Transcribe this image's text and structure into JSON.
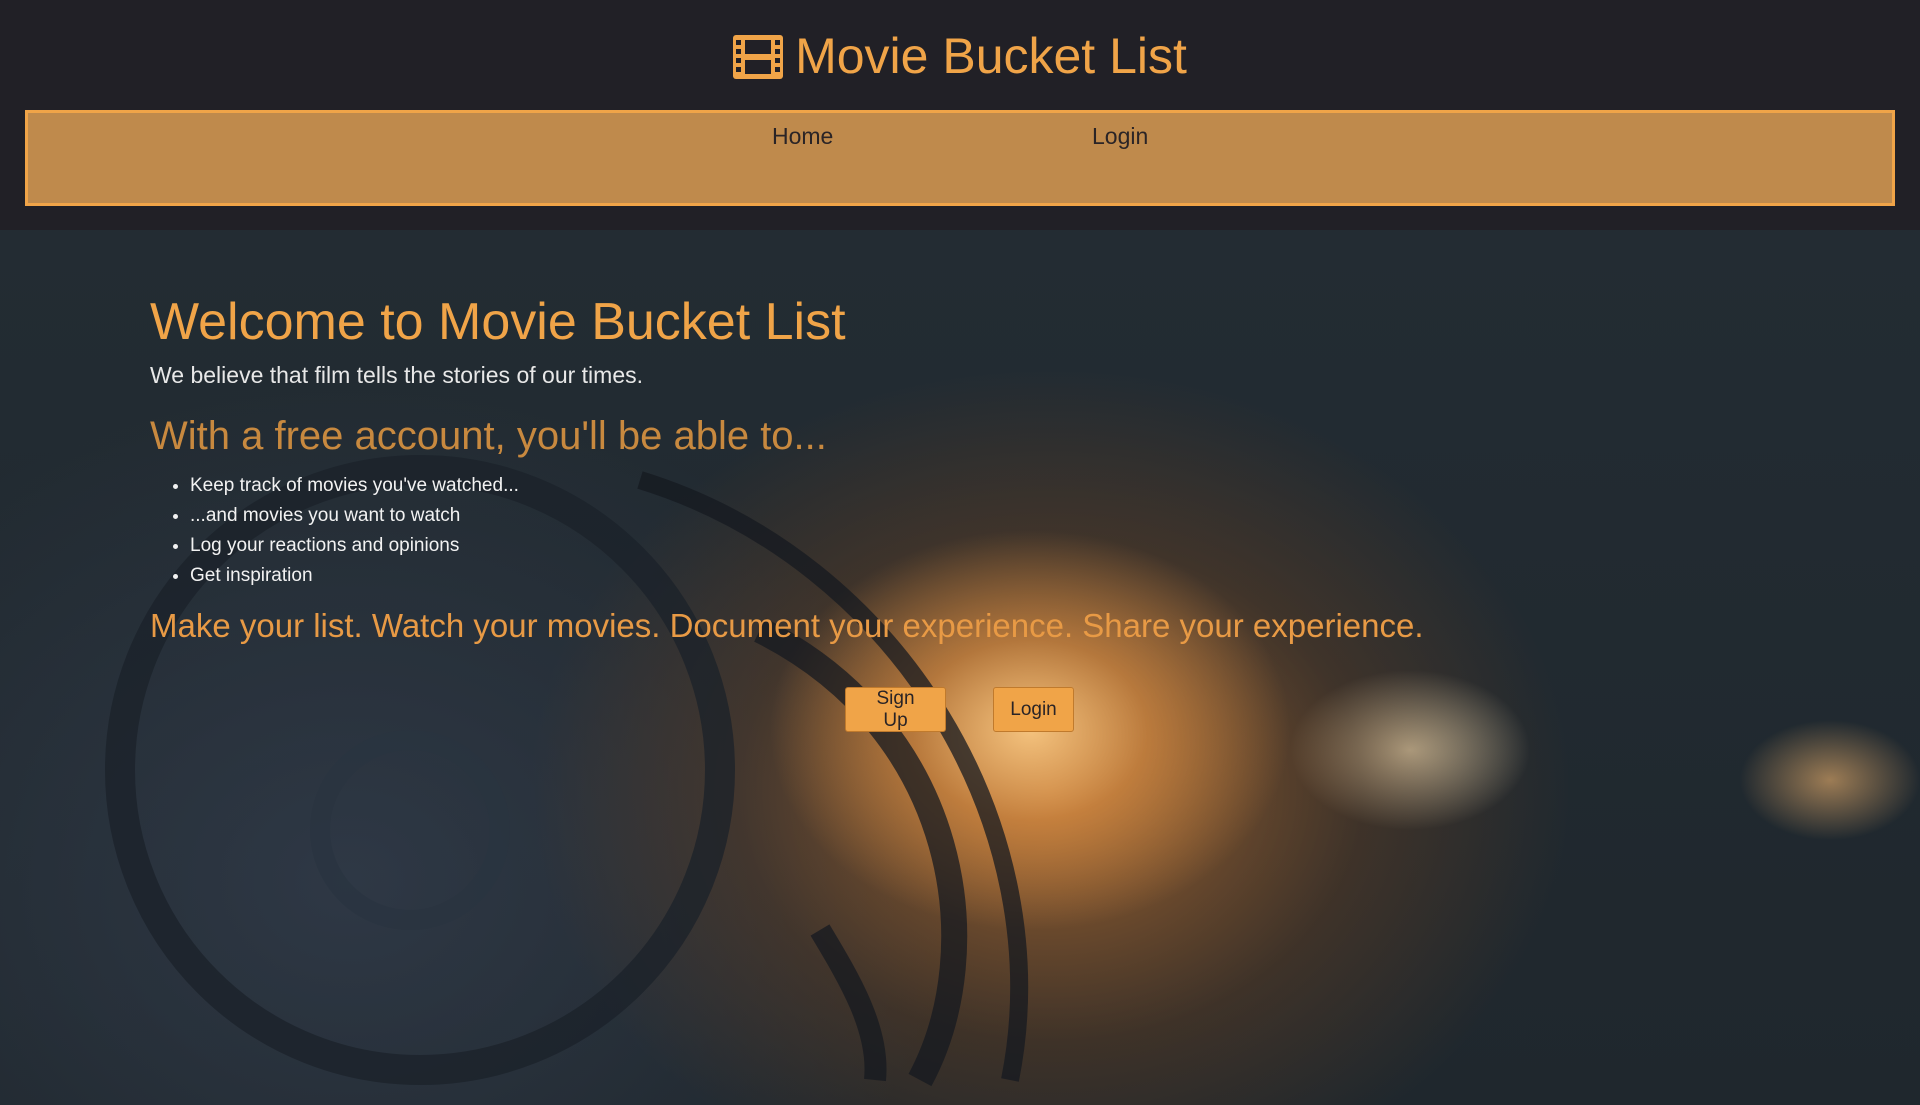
{
  "header": {
    "title": "Movie Bucket List",
    "icon": "film-icon",
    "accent": "#f0a448"
  },
  "nav": {
    "items": [
      {
        "label": "Home"
      },
      {
        "label": "Login"
      }
    ]
  },
  "hero": {
    "heading": "Welcome to Movie Bucket List",
    "subtitle": "We believe that film tells the stories of our times.",
    "features_heading": "With a free account, you'll be able to...",
    "features": [
      "Keep track of movies you've watched...",
      "...and movies you want to watch",
      "Log your reactions and opinions",
      "Get inspiration"
    ],
    "tagline": "Make your list. Watch your movies. Document your experience. Share your experience.",
    "signup_label": "Sign Up",
    "login_label": "Login"
  }
}
